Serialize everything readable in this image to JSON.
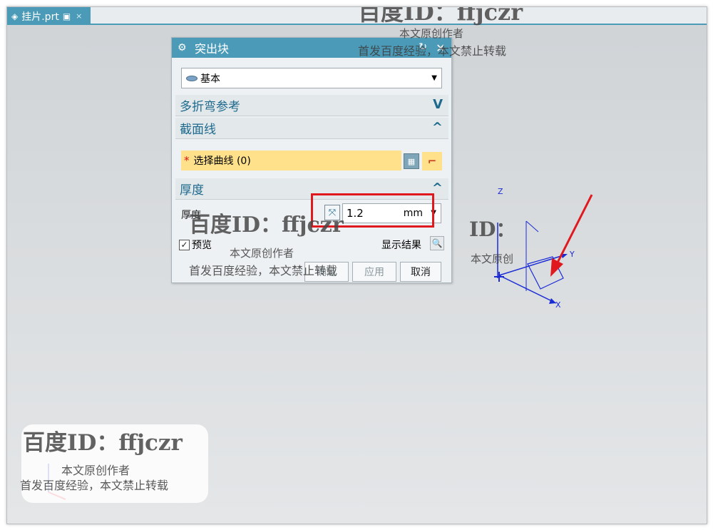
{
  "tab": {
    "title": "挂片.prt",
    "close": "×"
  },
  "dialog": {
    "title": "突出块",
    "type_value": "基本",
    "sections": {
      "multi_bend_ref": "多折弯参考",
      "section_curve": "截面线",
      "thickness": "厚度"
    },
    "select_curve_label": "选择曲线 (0)",
    "thickness_label": "厚度",
    "thickness_value": "1.2",
    "thickness_unit": "mm",
    "preview_label": "预览",
    "show_result_label": "显示结果",
    "buttons": {
      "ok": "确定",
      "apply": "应用",
      "cancel": "取消"
    }
  },
  "axes_labels": {
    "z": "Z",
    "y": "Y",
    "x": "X"
  },
  "watermark": {
    "id_text": "百度ID：ffjczr",
    "line1": "本文原创作者",
    "line2": "首发百度经验，本文禁止转载",
    "partial_id": "ID：",
    "partial_line": "本文原创"
  },
  "colors": {
    "accent": "#4b9bb8",
    "highlight_row": "#ffe18c",
    "red_annotation": "#e0191f",
    "axis_blue": "#1a2bd6"
  }
}
